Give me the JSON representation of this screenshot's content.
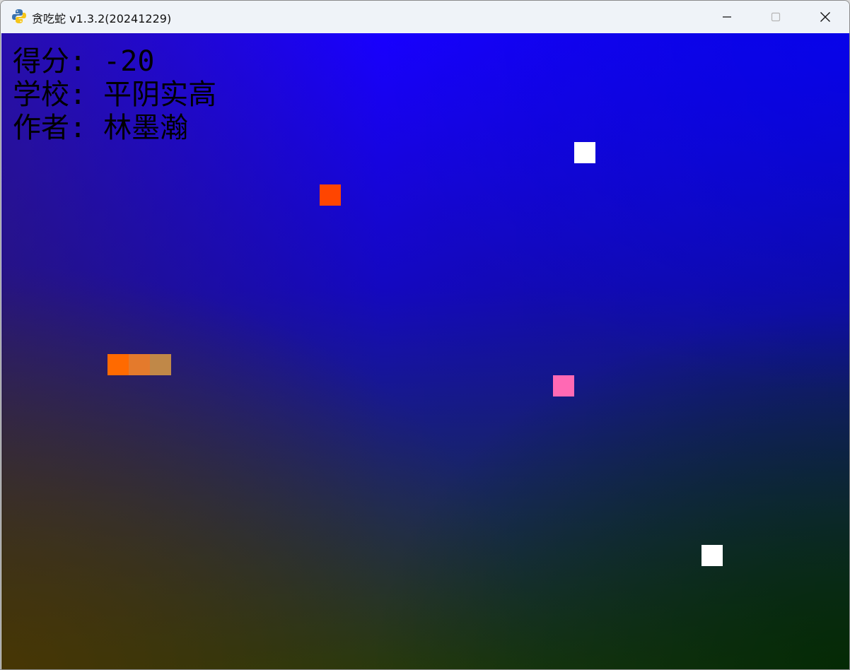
{
  "window": {
    "title": "贪吃蛇 v1.3.2(20241229)",
    "icon": "python-snake-icon",
    "controls": {
      "minimize": "minimize-icon",
      "maximize": "maximize-icon",
      "close": "close-icon"
    }
  },
  "hud": {
    "score_label": "得分: ",
    "score_value": "-20",
    "school_label": "学校: ",
    "school_value": "平阴实高",
    "author_label": "作者: ",
    "author_value": "林墨瀚"
  },
  "board": {
    "grid_cols": 40,
    "grid_rows": 30,
    "snake": [
      {
        "col": 5,
        "row": 15,
        "color": "#ff6a00"
      },
      {
        "col": 6,
        "row": 15,
        "color": "#e47a2c"
      },
      {
        "col": 7,
        "row": 15,
        "color": "#c08848"
      }
    ],
    "items": [
      {
        "kind": "food",
        "col": 15,
        "row": 7,
        "color": "#ff4500"
      },
      {
        "kind": "special",
        "col": 26,
        "row": 16,
        "color": "#ff69b4"
      },
      {
        "kind": "wall",
        "col": 27,
        "row": 5,
        "color": "#ffffff"
      },
      {
        "kind": "wall",
        "col": 33,
        "row": 24,
        "color": "#ffffff"
      }
    ]
  }
}
